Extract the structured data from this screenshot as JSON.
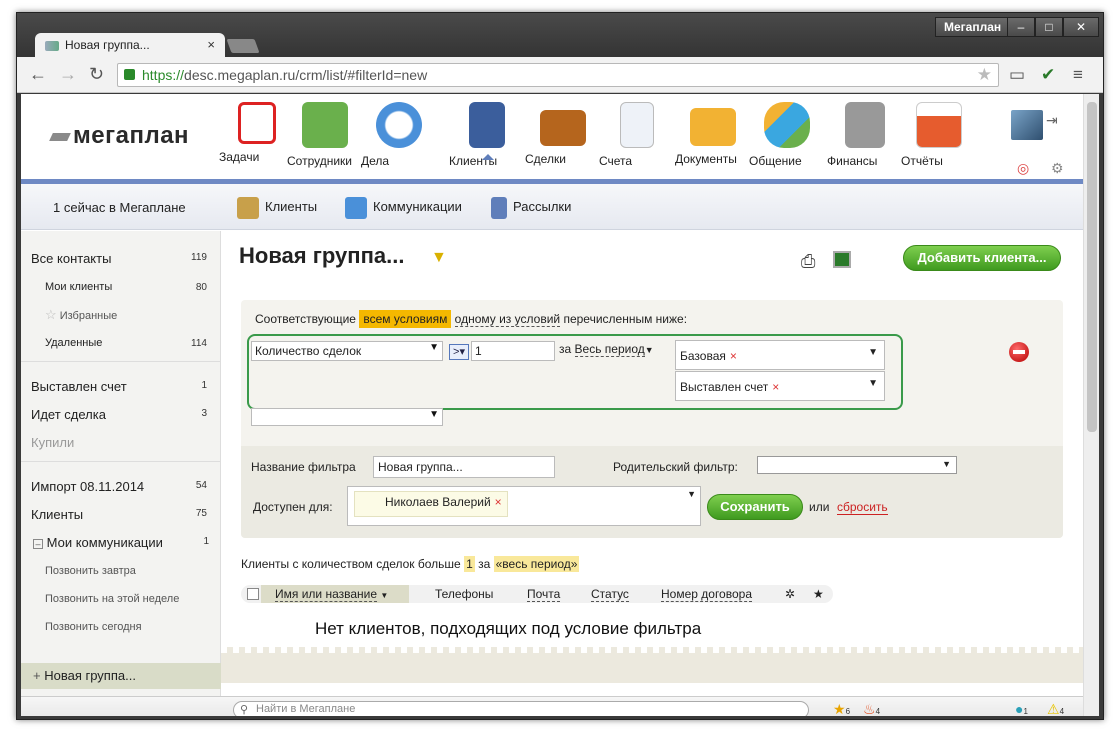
{
  "browser": {
    "app_badge": "Мегаплан",
    "tab_title": "Новая группа...",
    "tab_close": "×",
    "url_scheme": "https://",
    "url_rest": "desc.megaplan.ru/crm/list/#filterId=new"
  },
  "header": {
    "logo": "мегаплан",
    "modules": [
      {
        "label": "Задачи",
        "color": "#d22"
      },
      {
        "label": "Сотрудники",
        "color": "#6ab04c"
      },
      {
        "label": "Дела",
        "color": "#4a90d9"
      },
      {
        "label": "Клиенты",
        "color": "#3b5e9c"
      },
      {
        "label": "Сделки",
        "color": "#b5651d"
      },
      {
        "label": "Счета",
        "color": "#dfe6f0"
      },
      {
        "label": "Документы",
        "color": "#f2b233"
      },
      {
        "label": "Общение",
        "color": "#3aa7e0"
      },
      {
        "label": "Финансы",
        "color": "#999999"
      },
      {
        "label": "Отчёты",
        "color": "#e65c2e"
      }
    ]
  },
  "subnav": {
    "online": "1 сейчас в Мегаплане",
    "tabs": [
      "Клиенты",
      "Коммуникации",
      "Рассылки"
    ]
  },
  "sidebar": {
    "items": [
      {
        "label": "Все контакты",
        "count": "119"
      },
      {
        "label": "Мои клиенты",
        "count": "80"
      },
      {
        "label": "Избранные",
        "count": ""
      },
      {
        "label": "Удаленные",
        "count": "114"
      },
      {
        "label": "Выставлен счет",
        "count": "1"
      },
      {
        "label": "Идет сделка",
        "count": "3"
      },
      {
        "label": "Купили",
        "count": ""
      },
      {
        "label": "Импорт 08.11.2014",
        "count": "54"
      },
      {
        "label": "Клиенты",
        "count": "75"
      },
      {
        "label": "Мои коммуникации",
        "count": "1"
      },
      {
        "label": "Позвонить завтра",
        "count": ""
      },
      {
        "label": "Позвонить на этой неделе",
        "count": ""
      },
      {
        "label": "Позвонить сегодня",
        "count": ""
      }
    ],
    "new_group": "Новая группа..."
  },
  "main": {
    "title": "Новая группа...",
    "add_button": "Добавить клиента...",
    "filter": {
      "match_prefix": "Соответствующие",
      "all_conditions": "всем условиям",
      "any_condition": "одному из условий",
      "match_suffix": "перечисленным ниже:",
      "field": "Количество сделок",
      "operator": ">",
      "value": "1",
      "period_prefix": "за",
      "period": "Весь период",
      "tags": [
        "Базовая",
        "Выставлен счет"
      ],
      "tag_remove": "×",
      "name_label": "Название фильтра",
      "name_value": "Новая группа...",
      "parent_label": "Родительский фильтр:",
      "available_label": "Доступен для:",
      "available_user": "Николаев Валерий",
      "save": "Сохранить",
      "or": "или",
      "reset": "сбросить"
    },
    "summary": {
      "prefix": "Клиенты с количеством сделок больше",
      "value": "1",
      "mid": "за",
      "period": "«весь период»"
    },
    "columns": [
      "Имя или название",
      "Телефоны",
      "Почта",
      "Статус",
      "Номер договора"
    ],
    "empty": "Нет клиентов, подходящих под условие фильтра"
  },
  "bottombar": {
    "search_placeholder": "Найти в Мегаплане",
    "star_count": "6",
    "fire_count": "4",
    "chat_count": "1",
    "alert_count": "4"
  }
}
